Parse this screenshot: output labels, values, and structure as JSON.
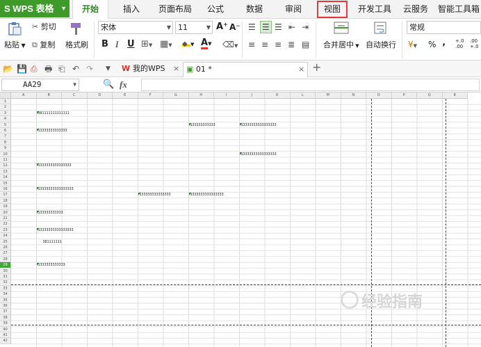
{
  "app": {
    "name": "WPS 表格"
  },
  "menu": {
    "tabs": [
      {
        "label": "开始",
        "active": true
      },
      {
        "label": "插入"
      },
      {
        "label": "页面布局"
      },
      {
        "label": "公式"
      },
      {
        "label": "数据"
      },
      {
        "label": "审阅"
      },
      {
        "label": "视图",
        "highlighted": true
      },
      {
        "label": "开发工具"
      },
      {
        "label": "云服务"
      },
      {
        "label": "智能工具箱"
      }
    ]
  },
  "ribbon": {
    "cut": "剪切",
    "paste": "粘贴",
    "copy": "复制",
    "format_painter": "格式刷",
    "font_name": "宋体",
    "font_size": "11",
    "grow": "A⁺",
    "shrink": "A⁻",
    "bold": "B",
    "italic": "I",
    "underline": "U",
    "merge_center": "合并居中",
    "wrap_text": "自动换行",
    "number_format": "常规",
    "percent": "%",
    "comma": "‚",
    "inc_decimal": "+.0 .00",
    "dec_decimal": ".00 +.0"
  },
  "doc_tabs": [
    {
      "label": "我的WPS"
    },
    {
      "label": "01 *",
      "active": true
    }
  ],
  "formula_bar": {
    "name_box": "AA29",
    "fx": "fx",
    "formula": ""
  },
  "sheet": {
    "columns": [
      "A",
      "B",
      "C",
      "D",
      "E",
      "F",
      "G",
      "H",
      "I",
      "J",
      "K",
      "L",
      "M",
      "N",
      "O",
      "P",
      "Q",
      "R"
    ],
    "rows": [
      "1",
      "2",
      "3",
      "4",
      "5",
      "6",
      "7",
      "8",
      "9",
      "10",
      "11",
      "12",
      "13",
      "14",
      "15",
      "16",
      "17",
      "18",
      "19",
      "20",
      "21",
      "22",
      "23",
      "24",
      "25",
      "26",
      "27",
      "28",
      "29",
      "30",
      "31",
      "32",
      "33",
      "34",
      "35",
      "36",
      "37",
      "38",
      "39",
      "40",
      "41",
      "42"
    ],
    "selected_row": "29",
    "cells": [
      {
        "col": 1,
        "row": 2,
        "text": "381111111111111"
      },
      {
        "col": 1,
        "row": 5,
        "text": "13333333333333"
      },
      {
        "col": 7,
        "row": 4,
        "text": "133333333333"
      },
      {
        "col": 9,
        "row": 4,
        "text": "13333333333333333"
      },
      {
        "col": 9,
        "row": 9,
        "text": "13333333333333333"
      },
      {
        "col": 1,
        "row": 11,
        "text": "1333333333333333"
      },
      {
        "col": 1,
        "row": 15,
        "text": "13333333333333333"
      },
      {
        "col": 5,
        "row": 16,
        "text": "133333333333333"
      },
      {
        "col": 7,
        "row": 16,
        "text": "1333333333333333"
      },
      {
        "col": 1,
        "row": 19,
        "text": "133333333333"
      },
      {
        "col": 1,
        "row": 22,
        "text": "13333333333333333"
      },
      {
        "col": 1,
        "row": 24,
        "text": "381111111",
        "indent": true,
        "no_marker": true
      },
      {
        "col": 1,
        "row": 28,
        "text": "1333333333333"
      }
    ]
  },
  "watermark": "经验指南"
}
